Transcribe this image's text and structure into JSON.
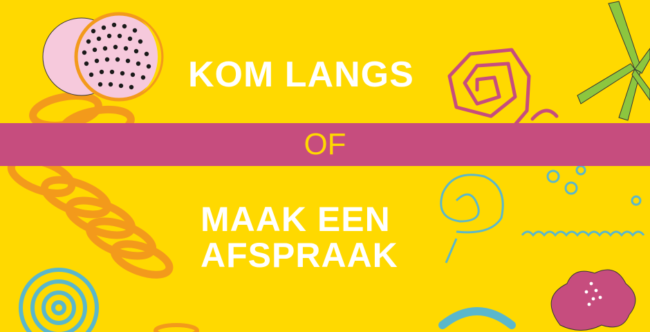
{
  "banner": {
    "line_top": "KOM LANGS",
    "band_text": "OF",
    "line_bottom_1": "MAAK EEN",
    "line_bottom_2": "AFSPRAAK"
  },
  "colors": {
    "background": "#ffd900",
    "band": "#c64d7e",
    "band_text": "#ffd900",
    "headline": "#ffffff",
    "orange": "#f39a1b",
    "magenta": "#c64d7e",
    "blue": "#5ab7cc",
    "green": "#8cc63f",
    "pink_light": "#f6c9dc"
  },
  "decorations": [
    "dotted-circle-icon",
    "orange-coil-icon",
    "magenta-spiral-icon",
    "green-starburst-icon",
    "blue-spiral-icon",
    "blue-swirl-icon",
    "flower-icon",
    "blue-wave-icon",
    "small-circles-icon"
  ]
}
